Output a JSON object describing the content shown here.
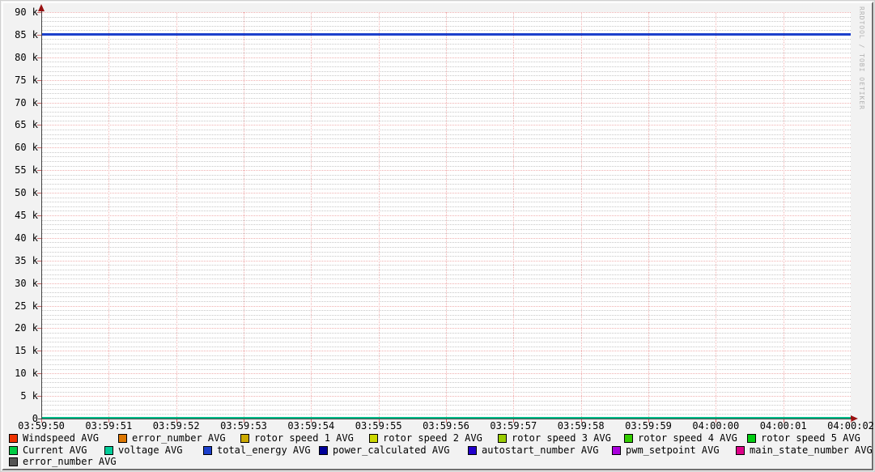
{
  "watermark": "RRDTOOL / TOBI OETIKER",
  "chart_data": {
    "type": "line",
    "title": "",
    "xlabel": "",
    "ylabel": "",
    "ylim": [
      0,
      90000
    ],
    "y_major_step": 5000,
    "y_minor_step": 1000,
    "grid": {
      "major_color": "#f0b0b0",
      "minor_color": "#c8c8c8",
      "grid_on": true
    },
    "legend_position": "bottom",
    "y_tick_labels": [
      "0",
      "5 k",
      "10 k",
      "15 k",
      "20 k",
      "25 k",
      "30 k",
      "35 k",
      "40 k",
      "45 k",
      "50 k",
      "55 k",
      "60 k",
      "65 k",
      "70 k",
      "75 k",
      "80 k",
      "85 k",
      "90 k"
    ],
    "x_tick_labels": [
      "03:59:50",
      "03:59:51",
      "03:59:52",
      "03:59:53",
      "03:59:54",
      "03:59:55",
      "03:59:56",
      "03:59:57",
      "03:59:58",
      "03:59:59",
      "04:00:00",
      "04:00:01",
      "04:00:02"
    ],
    "series": [
      {
        "name": "total_energy AVG",
        "color": "#1c40cc",
        "width": 3,
        "values": [
          85000,
          85000,
          85000,
          85000,
          85000,
          85000,
          85000,
          85000,
          85000,
          85000,
          85000,
          85000,
          85000
        ]
      },
      {
        "name": "voltage AVG",
        "color": "#00bb88",
        "width": 2,
        "values": [
          0,
          0,
          0,
          0,
          0,
          0,
          0,
          0,
          0,
          0,
          0,
          0,
          0
        ]
      }
    ],
    "legend": [
      {
        "label": "Windspeed AVG",
        "color": "#ee3300"
      },
      {
        "label": "error_number AVG",
        "color": "#dd7700"
      },
      {
        "label": "rotor speed 1 AVG",
        "color": "#ccaa00"
      },
      {
        "label": "rotor speed 2 AVG",
        "color": "#ccd800"
      },
      {
        "label": "rotor speed 3 AVG",
        "color": "#99cc00"
      },
      {
        "label": "rotor speed 4 AVG",
        "color": "#33cc00"
      },
      {
        "label": "rotor speed 5 AVG",
        "color": "#00cc11"
      },
      {
        "label": "Current AVG",
        "color": "#00cc44"
      },
      {
        "label": "voltage AVG",
        "color": "#00cc99"
      },
      {
        "label": "total_energy AVG",
        "color": "#1c40cc"
      },
      {
        "label": "power_calculated AVG",
        "color": "#000099"
      },
      {
        "label": "autostart_number AVG",
        "color": "#2200cc"
      },
      {
        "label": "pwm_setpoint AVG",
        "color": "#aa00dd"
      },
      {
        "label": "main_state_number AVG",
        "color": "#dd0088"
      },
      {
        "label": "error_number AVG",
        "color": "#555555"
      }
    ]
  }
}
